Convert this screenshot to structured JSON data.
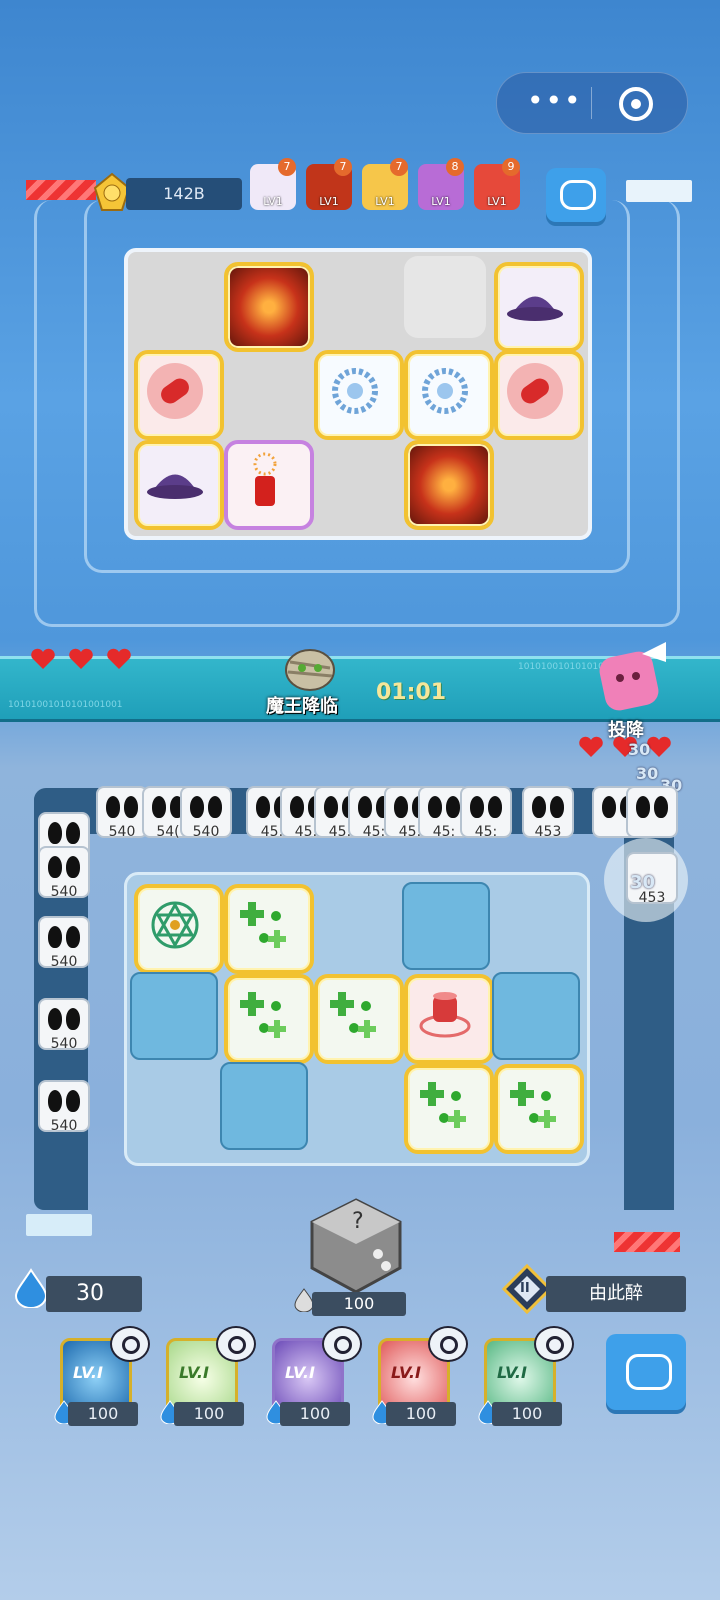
{
  "opponent": {
    "score": "142B",
    "rank_icon": "crown-rank-icon",
    "deck": [
      {
        "lv": "LV1",
        "badge": "7",
        "icon": "witch-hat-icon",
        "color": "#f0e9f8"
      },
      {
        "lv": "LV1",
        "badge": "7",
        "icon": "fire-icon",
        "color": "#c1351a"
      },
      {
        "lv": "LV1",
        "badge": "7",
        "icon": "sun-icon",
        "color": "#f6c64a"
      },
      {
        "lv": "LV1",
        "badge": "8",
        "icon": "firecracker-icon",
        "color": "#b86cd6"
      },
      {
        "lv": "LV1",
        "badge": "9",
        "icon": "bullet-icon",
        "color": "#e6493a"
      }
    ]
  },
  "battle": {
    "boss_title": "魔王降临",
    "timer": "01:01",
    "surrender_label": "投降",
    "binary_text": "10101001010101001001",
    "my_hearts": 3,
    "opp_hearts": 3
  },
  "monsters": {
    "top_hp": [
      "540",
      "54(",
      "540",
      "45:",
      "45:",
      "45:",
      "45:",
      "45:",
      "45:",
      "45:",
      "453"
    ],
    "left_hp": [
      "540",
      "540",
      "540",
      "540",
      "540"
    ],
    "corner_hp": "453",
    "damage_texts": [
      "30",
      "30",
      "30",
      "30",
      "30"
    ]
  },
  "player": {
    "sp": "30",
    "roll_cost": "100",
    "name": "由此醉",
    "rank": "II",
    "deck": [
      {
        "lv": "LV.I",
        "cost": "100",
        "icon": "wind-icon",
        "color": "#2a8ad0"
      },
      {
        "lv": "LV.I",
        "cost": "100",
        "icon": "plus-icon",
        "color": "#7cc043"
      },
      {
        "lv": "LV.I",
        "cost": "100",
        "icon": "lightning-icon",
        "color": "#7a5ac4"
      },
      {
        "lv": "LV.I",
        "cost": "100",
        "icon": "target-icon",
        "color": "#e04848"
      },
      {
        "lv": "LV.I",
        "cost": "100",
        "icon": "compass-icon",
        "color": "#3aa57e"
      }
    ]
  }
}
